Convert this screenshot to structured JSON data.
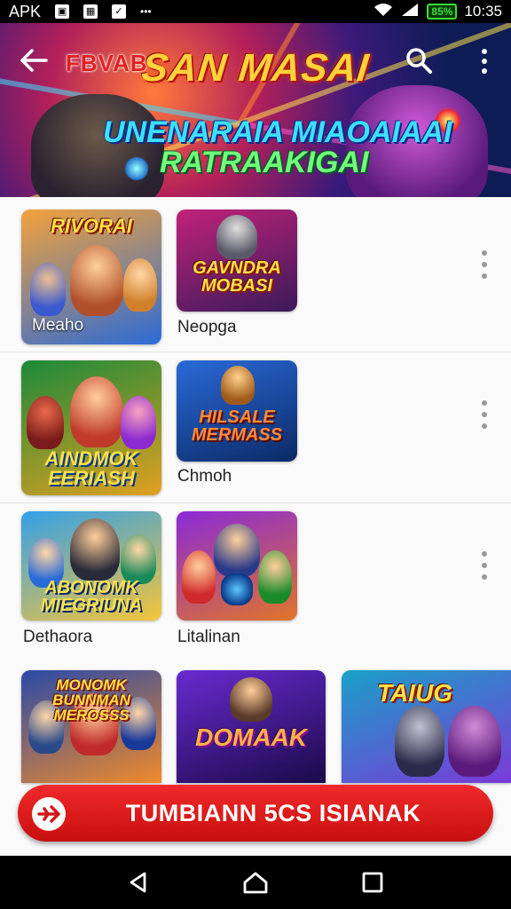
{
  "status_bar": {
    "carrier": "APK",
    "time": "10:35",
    "battery": "85%",
    "notification_icons": [
      "app-icon",
      "image-icon",
      "check-icon"
    ],
    "more": "•••"
  },
  "header": {
    "app_name": "FBVAB",
    "title": "SAN MASAI",
    "subtitle_line1": "UNENARAIA MIAOAIAAI",
    "subtitle_line2": "RATRAAKIGAI",
    "icons": [
      "back-arrow-icon",
      "search-icon",
      "more-vert-icon"
    ]
  },
  "rows": [
    {
      "tiles": [
        {
          "art_title": "RIVORAI",
          "caption": "Meaho",
          "colors": [
            "#f3a23a",
            "#2c6bd6"
          ]
        },
        {
          "art_title": "GAVNDRA MOBASI",
          "caption": "Neopga",
          "colors": [
            "#c1227a",
            "#3a1a5a"
          ]
        }
      ]
    },
    {
      "tiles": [
        {
          "art_title": "AINDMOK EERIASH",
          "caption": "",
          "colors": [
            "#1c8a3a",
            "#e0a020"
          ]
        },
        {
          "art_title": "HILSALE MERMASS",
          "caption": "Chmoh",
          "colors": [
            "#2a6ad8",
            "#0b2a66"
          ]
        }
      ]
    },
    {
      "tiles": [
        {
          "art_title": "ABONOMK MIEGRIUNA",
          "caption": "Dethaora",
          "colors": [
            "#34a0e8",
            "#f5c53a"
          ]
        },
        {
          "art_title": "",
          "caption": "Litalinan",
          "colors": [
            "#8a2ad8",
            "#e0742a"
          ]
        }
      ]
    },
    {
      "tiles": [
        {
          "art_title": "MONOMK BUNNMAN MEROSSS",
          "caption": "",
          "colors": [
            "#2a4aa8",
            "#f08a2a"
          ]
        },
        {
          "art_title": "DOMAAK",
          "caption": "",
          "colors": [
            "#6a2ad0",
            "#1a0a4a"
          ]
        },
        {
          "art_title": "TAIUG",
          "caption": "",
          "colors": [
            "#1aa0c8",
            "#7a3ad8"
          ]
        }
      ]
    }
  ],
  "cta": {
    "label": "TUMBIANN 5CS ISIANAK",
    "icon": "plane-icon",
    "color": "#e41b1b"
  },
  "nav_bar": {
    "icons": [
      "back-icon",
      "home-icon",
      "recents-icon"
    ]
  }
}
